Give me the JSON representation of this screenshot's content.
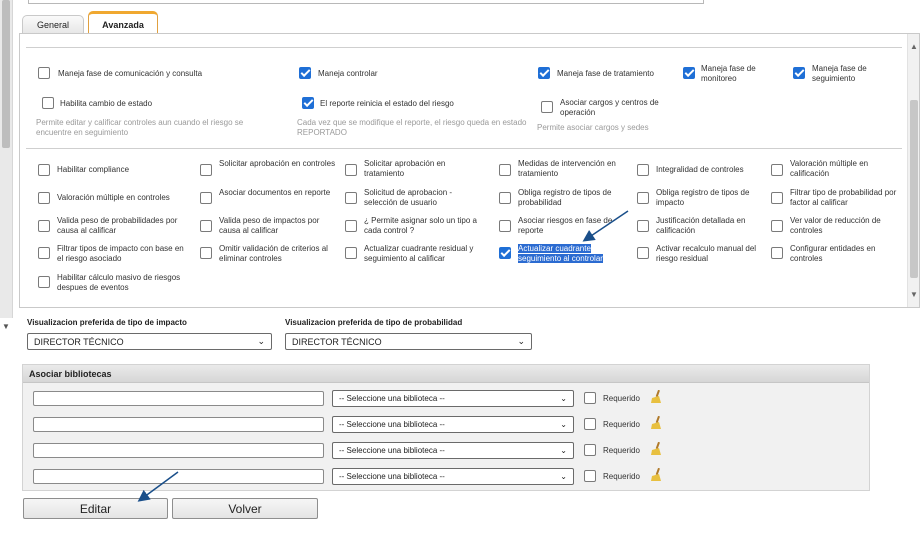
{
  "tabs": [
    {
      "label": "General"
    },
    {
      "label": "Avanzada"
    }
  ],
  "section1": {
    "row1": [
      {
        "label": "Maneja fase de comunicación y consulta",
        "checked": false
      },
      {
        "label": "Maneja controlar",
        "checked": true
      },
      {
        "label": "Maneja fase de tratamiento",
        "checked": true
      },
      {
        "label": "Maneja fase de monitoreo",
        "checked": true
      },
      {
        "label": "Maneja fase de seguimiento",
        "checked": true
      }
    ],
    "row2": [
      {
        "label": "Habilita cambio de estado",
        "checked": false,
        "note": "Permite editar y calificar controles aun cuando el riesgo se encuentre en seguimiento"
      },
      {
        "label": "El reporte reinicia el estado del riesgo",
        "checked": true,
        "note": "Cada vez que se modifique el reporte, el riesgo queda en estado REPORTADO"
      },
      {
        "label": "Asociar cargos y centros de operación",
        "checked": false,
        "note": "Permite asociar cargos y sedes"
      }
    ]
  },
  "section2": {
    "columns": [
      [
        {
          "label": "Habilitar compliance",
          "checked": false
        },
        {
          "label": "Valoración múltiple en controles",
          "checked": false
        },
        {
          "label": "Valida peso de probabilidades por causa al calificar",
          "checked": false
        },
        {
          "label": "Filtrar tipos de impacto con base en el riesgo asociado",
          "checked": false
        },
        {
          "label": "Habilitar cálculo masivo de riesgos despues de eventos",
          "checked": false
        }
      ],
      [
        {
          "label": "Solicitar aprobación en controles",
          "checked": false
        },
        {
          "label": "Asociar documentos en reporte",
          "checked": false
        },
        {
          "label": "Valida peso de impactos por causa al calificar",
          "checked": false
        },
        {
          "label": "Omitir validación de criterios al eliminar controles",
          "checked": false
        }
      ],
      [
        {
          "label": "Solicitar aprobación en tratamiento",
          "checked": false
        },
        {
          "label": "Solicitud de aprobacion - selección de usuario",
          "checked": false
        },
        {
          "label": "¿ Permite asignar solo un tipo a cada control ?",
          "checked": false
        },
        {
          "label": "Actualizar cuadrante residual y seguimiento al calificar",
          "checked": false
        }
      ],
      [
        {
          "label": "Medidas de intervención en tratamiento",
          "checked": false
        },
        {
          "label": "Obliga registro de tipos de probabilidad",
          "checked": false
        },
        {
          "label": "Asociar riesgos en fase de reporte",
          "checked": false
        },
        {
          "label": "Actualizar cuadrante seguimiento al controlar",
          "checked": true,
          "highlighted": true
        }
      ],
      [
        {
          "label": "Integralidad de controles",
          "checked": false
        },
        {
          "label": "Obliga registro de tipos de impacto",
          "checked": false
        },
        {
          "label": "Justificación detallada en calificación",
          "checked": false
        },
        {
          "label": "Activar recalculo manual del riesgo residual",
          "checked": false
        }
      ],
      [
        {
          "label": "Valoración múltiple en calificación",
          "checked": false
        },
        {
          "label": "Filtrar tipo de probabilidad por factor al calificar",
          "checked": false
        },
        {
          "label": "Ver valor de reducción de controles",
          "checked": false
        },
        {
          "label": "Configurar entidades en controles",
          "checked": false
        }
      ]
    ]
  },
  "visualization": {
    "impact_label": "Visualizacion preferida de tipo de impacto",
    "impact_value": "DIRECTOR TÉCNICO",
    "prob_label": "Visualizacion preferida de tipo de probabilidad",
    "prob_value": "DIRECTOR TÉCNICO"
  },
  "libraries": {
    "title": "Asociar bibliotecas",
    "rows": [
      {
        "name": "",
        "select": "-- Seleccione una biblioteca --",
        "required_label": "Requerido",
        "required": false
      },
      {
        "name": "",
        "select": "-- Seleccione una biblioteca --",
        "required_label": "Requerido",
        "required": false
      },
      {
        "name": "",
        "select": "-- Seleccione una biblioteca --",
        "required_label": "Requerido",
        "required": false
      },
      {
        "name": "",
        "select": "-- Seleccione una biblioteca --",
        "required_label": "Requerido",
        "required": false
      }
    ]
  },
  "buttons": {
    "edit": "Editar",
    "back": "Volver"
  },
  "colors": {
    "accent": "#1f6fd6",
    "arrow": "#1a4f8a",
    "tab_accent": "#f0a830"
  }
}
